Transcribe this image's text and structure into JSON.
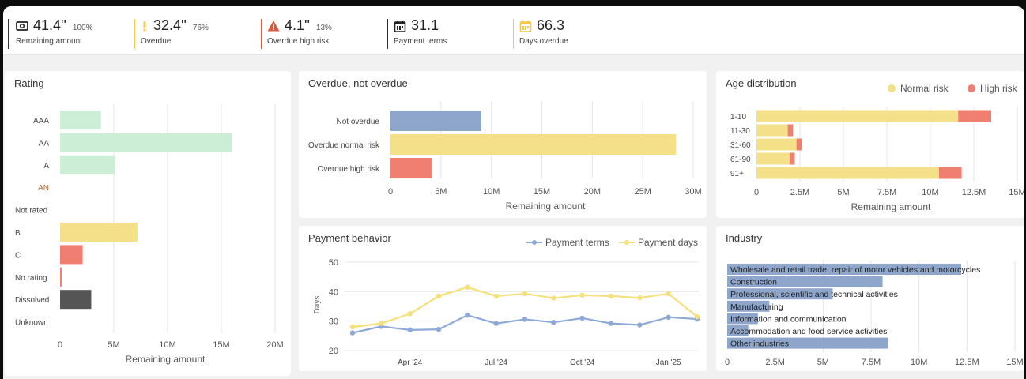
{
  "kpis": [
    {
      "value": "41.4''",
      "pct": "100%",
      "label": "Remaining amount",
      "icon": "cash-icon"
    },
    {
      "value": "32.4''",
      "pct": "76%",
      "label": "Overdue",
      "icon": "exclamation-icon"
    },
    {
      "value": "4.1''",
      "pct": "13%",
      "label": "Overdue high risk",
      "icon": "warning-icon"
    },
    {
      "value": "31.1",
      "pct": "",
      "label": "Payment terms",
      "icon": "calendar-icon"
    },
    {
      "value": "66.3",
      "pct": "",
      "label": "Days overdue",
      "icon": "calendar-overdue-icon"
    }
  ],
  "colors": {
    "green": "#cdeed6",
    "yellow": "#f5e08a",
    "red": "#f07f72",
    "blue": "#8fa6cc",
    "dark": "#555555",
    "kpi_sep_dark": "#333333",
    "kpi_sep_yellow": "#f2c94c",
    "kpi_sep_red": "#e0563a",
    "line_blue": "#8ea9d8",
    "line_yellow": "#f5e07a"
  },
  "rating": {
    "title": "Rating",
    "xlabel": "Remaining amount",
    "ticks": [
      "0",
      "5M",
      "10M",
      "15M",
      "20M"
    ]
  },
  "overdue": {
    "title": "Overdue, not overdue",
    "xlabel": "Remaining amount",
    "ticks": [
      "0",
      "5M",
      "10M",
      "15M",
      "20M",
      "25M",
      "30M"
    ]
  },
  "age": {
    "title": "Age distribution",
    "xlabel": "Remaining amount",
    "legend": [
      "Normal risk",
      "High risk"
    ],
    "ticks": [
      "0",
      "2.5M",
      "5M",
      "7.5M",
      "10M",
      "12.5M",
      "15M"
    ]
  },
  "payment": {
    "title": "Payment behavior",
    "ylabel": "Days",
    "legend": [
      "Payment terms",
      "Payment days"
    ],
    "yticks": [
      "50",
      "40",
      "30",
      "20"
    ],
    "xticks": [
      "Apr '24",
      "Jul '24",
      "Oct '24",
      "Jan '25"
    ]
  },
  "industry": {
    "title": "Industry",
    "ticks": [
      "0",
      "2.5M",
      "5M",
      "7.5M",
      "10M",
      "12.5M",
      "15M"
    ]
  },
  "chart_data": [
    {
      "type": "bar",
      "title": "Rating",
      "xlabel": "Remaining amount",
      "orientation": "horizontal",
      "categories": [
        "AAA",
        "AA",
        "A",
        "AN",
        "Not rated",
        "B",
        "C",
        "No rating",
        "Dissolved",
        "Unknown"
      ],
      "values": [
        3800000,
        16000000,
        5100000,
        0,
        0,
        7200000,
        2100000,
        150000,
        2900000,
        0
      ],
      "colors": [
        "green",
        "green",
        "green",
        "green",
        "green",
        "yellow",
        "red",
        "red",
        "dark",
        "dark"
      ],
      "xlim": [
        0,
        20000000
      ]
    },
    {
      "type": "bar",
      "title": "Overdue, not overdue",
      "xlabel": "Remaining amount",
      "orientation": "horizontal",
      "categories": [
        "Not overdue",
        "Overdue normal risk",
        "Overdue high risk"
      ],
      "values": [
        9000000,
        28300000,
        4100000
      ],
      "colors": [
        "blue",
        "yellow",
        "red"
      ],
      "xlim": [
        0,
        30000000
      ]
    },
    {
      "type": "bar",
      "title": "Age distribution",
      "xlabel": "Remaining amount",
      "orientation": "horizontal",
      "stacked": true,
      "categories": [
        "1-10",
        "11-30",
        "31-60",
        "61-90",
        "91+"
      ],
      "series": [
        {
          "name": "Normal risk",
          "values": [
            11600000,
            1800000,
            2300000,
            1900000,
            10500000
          ]
        },
        {
          "name": "High risk",
          "values": [
            1900000,
            300000,
            300000,
            300000,
            1300000
          ]
        }
      ],
      "xlim": [
        0,
        15000000
      ],
      "legend": "top-right"
    },
    {
      "type": "line",
      "title": "Payment behavior",
      "ylabel": "Days",
      "x": [
        "Feb '24",
        "Mar '24",
        "Apr '24",
        "May '24",
        "Jun '24",
        "Jul '24",
        "Aug '24",
        "Sep '24",
        "Oct '24",
        "Nov '24",
        "Dec '24",
        "Jan '25",
        "Feb '25"
      ],
      "series": [
        {
          "name": "Payment terms",
          "values": [
            26,
            28.2,
            27,
            27.2,
            32,
            29.2,
            30.6,
            29.6,
            31,
            29.2,
            28.7,
            31.3,
            30.7
          ]
        },
        {
          "name": "Payment days",
          "values": [
            28,
            29.2,
            32.5,
            38.5,
            41.5,
            38.5,
            39.3,
            37.8,
            38.8,
            38.5,
            37.9,
            39.3,
            31.5
          ]
        }
      ],
      "ylim": [
        20,
        50
      ],
      "legend": "top-right",
      "grid": true
    },
    {
      "type": "bar",
      "title": "Industry",
      "orientation": "horizontal",
      "categories": [
        "Wholesale and retail trade; repair of motor vehicles and motorcycles",
        "Construction",
        "Professional, scientific and technical activities",
        "Manufacturing",
        "Information and communication",
        "Accommodation and food service activities",
        "Other industries"
      ],
      "values": [
        12200000,
        8100000,
        5500000,
        2200000,
        1600000,
        1100000,
        8400000
      ],
      "xlim": [
        0,
        15000000
      ]
    }
  ]
}
